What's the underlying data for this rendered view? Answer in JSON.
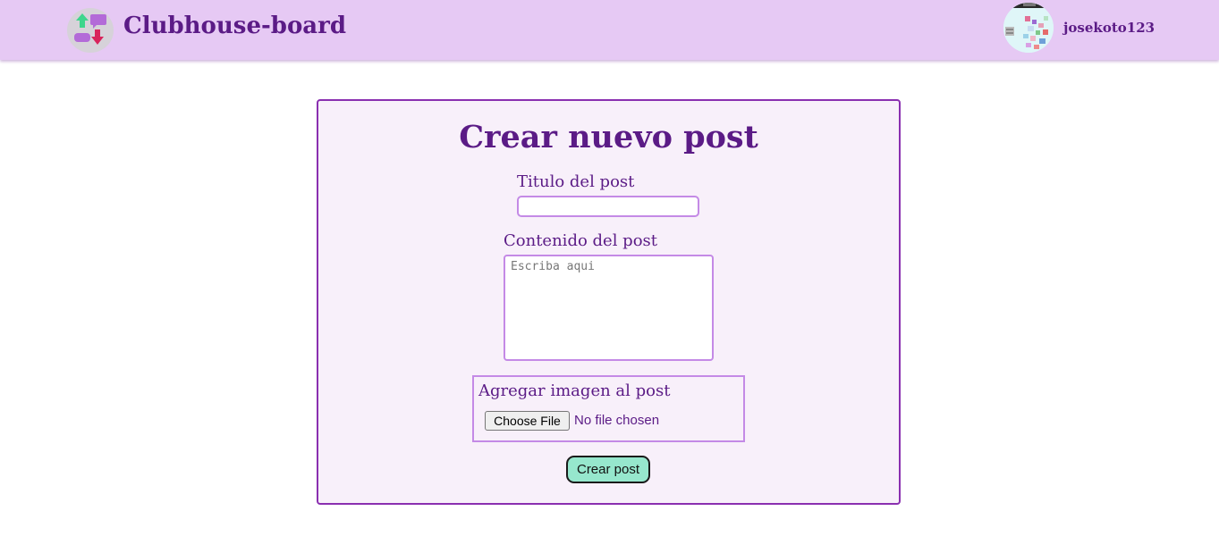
{
  "header": {
    "brand": "Clubhouse-board",
    "username": "josekoto123"
  },
  "form": {
    "title": "Crear nuevo post",
    "title_label": "Titulo del post",
    "title_value": "",
    "content_label": "Contenido del post",
    "content_placeholder": "Escriba aqui",
    "image_label": "Agregar imagen al post",
    "file_button": "Choose File",
    "file_status": "No file chosen",
    "submit": "Crear post"
  },
  "colors": {
    "header_bg": "#e6c9f4",
    "brand_text": "#5b1b86",
    "card_border": "#8a2fb0",
    "input_border": "#c48ae6",
    "submit_bg": "#96e7cd"
  }
}
